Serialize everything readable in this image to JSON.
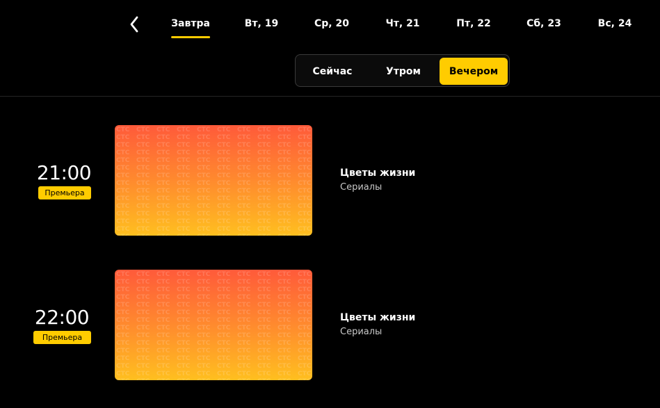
{
  "nav": {
    "days": [
      {
        "label": "Завтра",
        "active": true
      },
      {
        "label": "Вт, 19",
        "active": false
      },
      {
        "label": "Ср, 20",
        "active": false
      },
      {
        "label": "Чт, 21",
        "active": false
      },
      {
        "label": "Пт, 22",
        "active": false
      },
      {
        "label": "Сб, 23",
        "active": false
      },
      {
        "label": "Вс, 24",
        "active": false
      }
    ]
  },
  "time_filter": {
    "options": [
      "Сейчас",
      "Утром",
      "Вечером"
    ],
    "selected": "Вечером"
  },
  "schedule": [
    {
      "time": "21:00",
      "badge": "Премьера",
      "title": "Цветы жизни",
      "genre": "Сериалы",
      "thumb_watermark": "СТС"
    },
    {
      "time": "22:00",
      "badge": "Премьера",
      "title": "Цветы жизни",
      "genre": "Сериалы",
      "thumb_watermark": "СТС"
    }
  ],
  "colors": {
    "accent": "#ffcc00",
    "background": "#000000",
    "thumb_top": "#ff5a3a",
    "thumb_bottom": "#ffbf1f"
  }
}
